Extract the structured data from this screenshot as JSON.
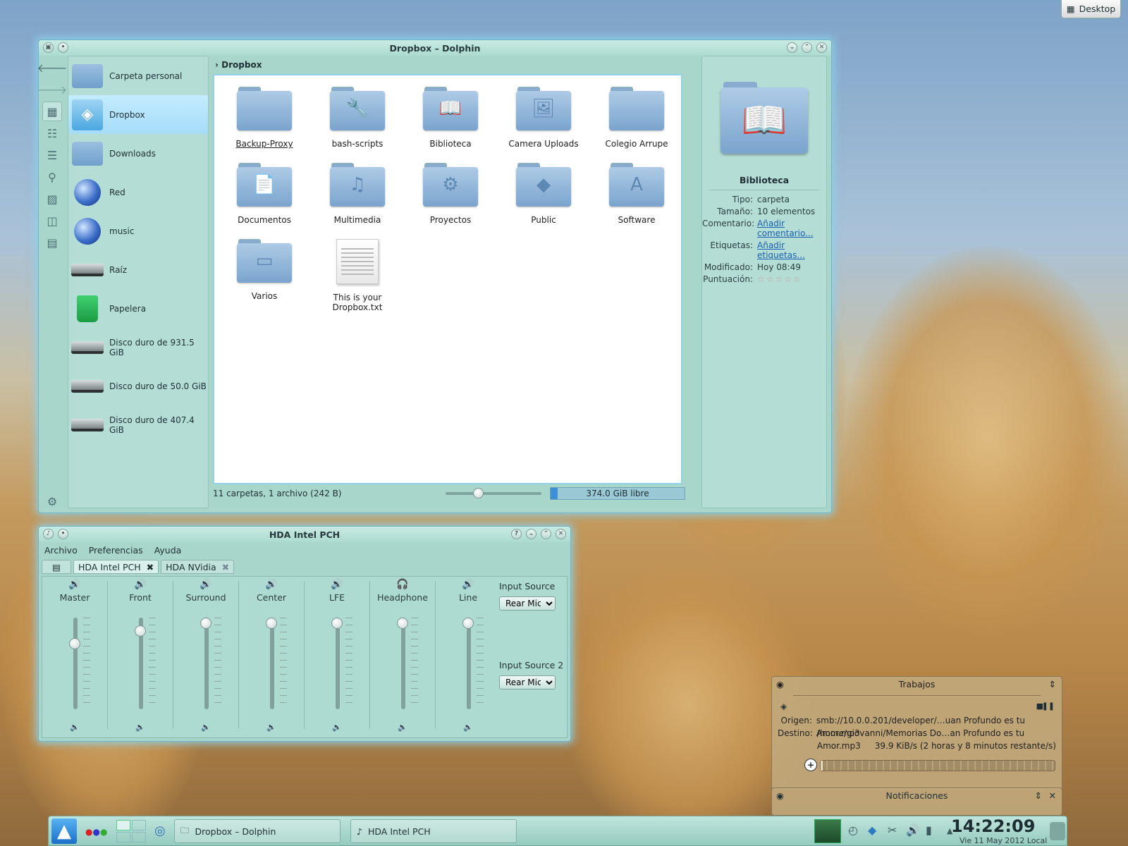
{
  "desktop_button": "Desktop",
  "dolphin": {
    "title": "Dropbox – Dolphin",
    "breadcrumb": "Dropbox",
    "places": [
      {
        "label": "Carpeta personal",
        "icon": "home-folder-icon"
      },
      {
        "label": "Dropbox",
        "icon": "dropbox-icon"
      },
      {
        "label": "Downloads",
        "icon": "downloads-folder-icon"
      },
      {
        "label": "Red",
        "icon": "network-globe-icon"
      },
      {
        "label": "music",
        "icon": "network-globe-icon"
      },
      {
        "label": "Raíz",
        "icon": "harddisk-icon"
      },
      {
        "label": "Papelera",
        "icon": "trash-icon"
      },
      {
        "label": "Disco duro de 931.5 GiB",
        "icon": "harddisk-icon"
      },
      {
        "label": "Disco duro de 50.0 GiB",
        "icon": "harddisk-icon"
      },
      {
        "label": "Disco duro de 407.4 GiB",
        "icon": "harddisk-icon"
      }
    ],
    "items": [
      {
        "label": "Backup-Proxy",
        "glyph": ""
      },
      {
        "label": "bash-scripts",
        "glyph": "🔧"
      },
      {
        "label": "Biblioteca",
        "glyph": "📖"
      },
      {
        "label": "Camera Uploads",
        "glyph": "🖼"
      },
      {
        "label": "Colegio Arrupe",
        "glyph": ""
      },
      {
        "label": "Documentos",
        "glyph": "📄"
      },
      {
        "label": "Multimedia",
        "glyph": "♫"
      },
      {
        "label": "Proyectos",
        "glyph": "⚙"
      },
      {
        "label": "Public",
        "glyph": "◆"
      },
      {
        "label": "Software",
        "glyph": "A"
      },
      {
        "label": "Varios",
        "glyph": "▭"
      },
      {
        "label": "This is your Dropbox.txt",
        "glyph": "txt"
      }
    ],
    "status": "11 carpetas, 1 archivo (242 B)",
    "free_space": "374.0 GiB libre",
    "zoom_slider_fraction": 0.32,
    "info": {
      "name": "Biblioteca",
      "rows": [
        {
          "k": "Tipo:",
          "v": "carpeta",
          "link": false
        },
        {
          "k": "Tamaño:",
          "v": "10 elementos",
          "link": false
        },
        {
          "k": "Comentario:",
          "v": "Añadir comentario...",
          "link": true
        },
        {
          "k": "Etiquetas:",
          "v": "Añadir etiquetas...",
          "link": true
        },
        {
          "k": "Modificado:",
          "v": "Hoy 08:49",
          "link": false
        },
        {
          "k": "Puntuación:",
          "v": "☆☆☆☆☆",
          "link": false
        }
      ]
    }
  },
  "mixer": {
    "title": "HDA Intel PCH",
    "menu": [
      "Archivo",
      "Preferencias",
      "Ayuda"
    ],
    "tabs": [
      "HDA Intel PCH",
      "HDA NVidia"
    ],
    "channels": [
      {
        "label": "Master",
        "level": 0.75
      },
      {
        "label": "Front",
        "level": 0.9
      },
      {
        "label": "Surround",
        "level": 1.0
      },
      {
        "label": "Center",
        "level": 1.0
      },
      {
        "label": "LFE",
        "level": 1.0
      },
      {
        "label": "Headphone",
        "level": 1.0
      },
      {
        "label": "Line",
        "level": 1.0
      }
    ],
    "input_source_label": "Input Source",
    "input_source_value": "Rear Mic",
    "input_source2_label": "Input Source 2",
    "input_source2_value": "Rear Mic"
  },
  "jobs": {
    "title": "Trabajos",
    "origen_label": "Origen:",
    "origen": "smb://10.0.0.201/developer/…uan Profundo es tu Amor.mp3",
    "destino_label": "Destino:",
    "destino": "/home/giovanni/Memorias Do…an Profundo es tu Amor.mp3",
    "speed": "39.9 KiB/s (2 horas y 8 minutos restante/s)",
    "progress": 0.01
  },
  "notifications_title": "Notificaciones",
  "taskbar": {
    "tasks": [
      "Dropbox – Dolphin",
      "HDA Intel PCH"
    ],
    "time": "14:22:09",
    "date": "Vie 11 May 2012 Local"
  }
}
